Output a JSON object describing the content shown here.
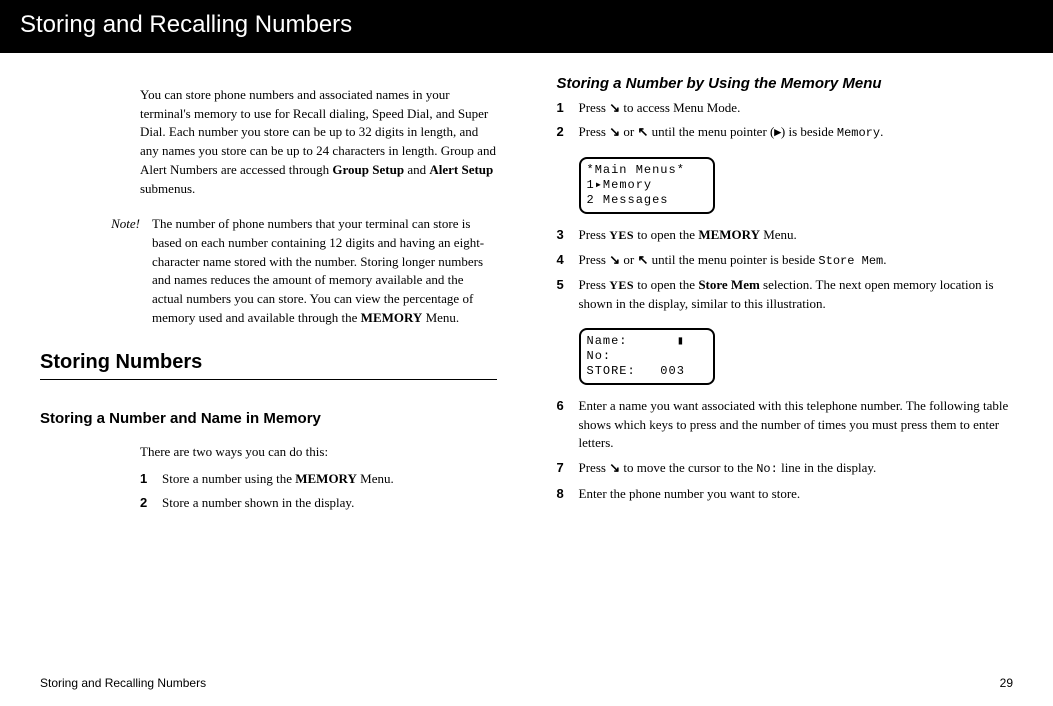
{
  "banner": "Storing and Recalling Numbers",
  "intro_p1_a": "You can store phone numbers and associated names in your terminal's memory to use for Recall dialing, Speed Dial, and Super Dial.  Each number you store can be up to 32 digits in length, and any names you store can be up to 24 characters in length. Group and Alert Numbers are accessed through ",
  "intro_group_setup": "Group Setup",
  "intro_and": " and ",
  "intro_alert_setup": "Alert Setup",
  "intro_p1_b": " submenus.",
  "note_label": "Note!",
  "note_text_a": "The number of phone numbers that your terminal can store is based on each number containing 12 digits and having an eight-character name stored with the number. Storing longer numbers and names reduces the amount of memory available and the actual numbers you can store.  You can view the percentage of memory used and available through the ",
  "note_text_mem": "MEMORY",
  "note_text_b": " Menu.",
  "section_storing": "Storing Numbers",
  "sub_store_name": "Storing a Number and Name in Memory",
  "sub_store_intro": "There are two ways you can do this:",
  "left_steps": {
    "s1_a": "Store a number using the ",
    "s1_mem": "MEMORY",
    "s1_b": " Menu.",
    "s2": "Store a number shown in the display."
  },
  "sub_memory_menu": "Storing a Number by Using the Memory Menu",
  "right_steps": {
    "s1_a": "Press ",
    "s1_b": " to access Menu Mode.",
    "s2_a": "Press ",
    "s2_b": " or ",
    "s2_c": " until the menu pointer (",
    "s2_d": ") is beside ",
    "s2_mem": "Memory",
    "s2_e": ".",
    "s3_a": "Press ",
    "s3_yes": "YES",
    "s3_b": " to open the ",
    "s3_mem": "MEMORY",
    "s3_c": " Menu.",
    "s4_a": "Press ",
    "s4_b": " or ",
    "s4_c": "  until the menu pointer is beside ",
    "s4_store": "Store Mem",
    "s4_d": ".",
    "s5_a": "Press ",
    "s5_yes": "YES",
    "s5_b": " to open the ",
    "s5_store": "Store Mem",
    "s5_c": " selection.  The next open memory location is shown in the display, similar to this illustration.",
    "s6": "Enter a name you want associated with this telephone number. The following table shows which keys to press and the number of times you must press them to enter letters.",
    "s7_a": "Press ",
    "s7_b": " to move the cursor to the ",
    "s7_no": "No:",
    "s7_c": " line in the display.",
    "s8": "Enter the phone number you want to store."
  },
  "lcd1": {
    "l1": "*Main Menus*",
    "l2": "1▸Memory",
    "l3": "2 Messages"
  },
  "lcd2": {
    "l1": "Name:      ▮",
    "l2": "No:",
    "l3": "STORE:   003"
  },
  "arrows": {
    "down": "↘",
    "up": "↖",
    "pointer": "▸"
  },
  "footer_left": "Storing and Recalling Numbers",
  "footer_right": "29"
}
